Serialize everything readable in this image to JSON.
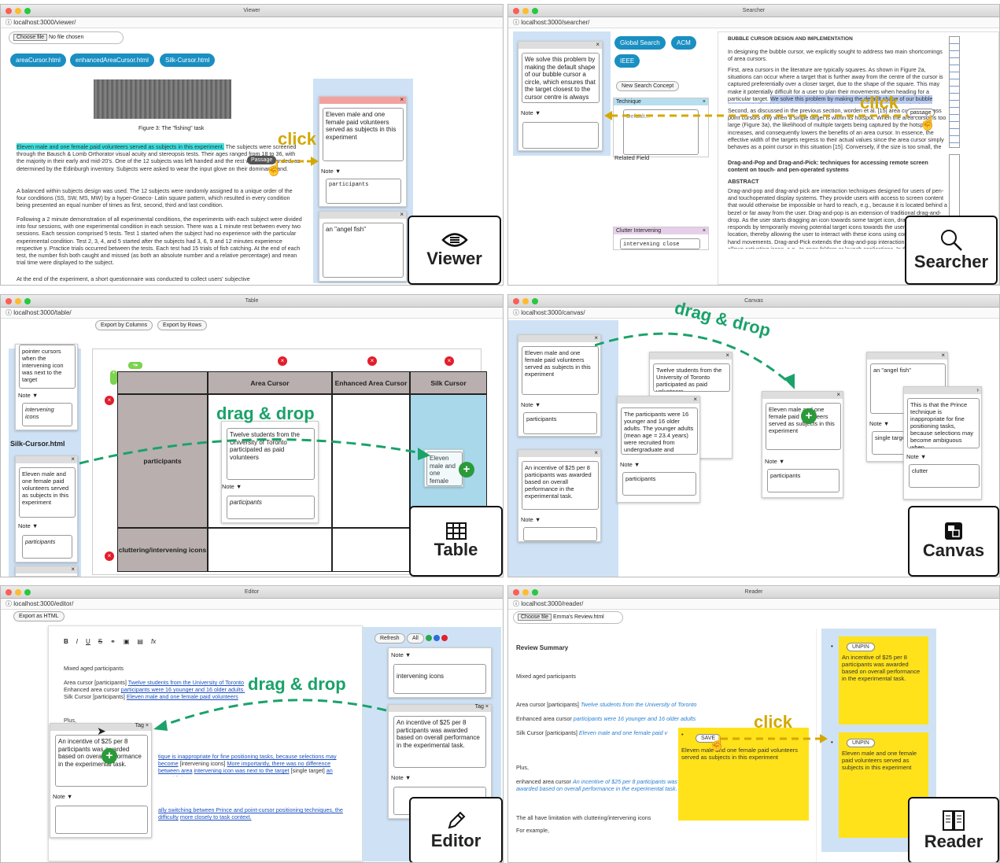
{
  "colors": {
    "accent": "#1a8fc2",
    "click": "#d4a800",
    "drag": "#1aa26a",
    "yellow": "#ffe21a",
    "panel": "#cfe2f5",
    "tableHead": "#b9afaf"
  },
  "viewer": {
    "title": "Viewer",
    "url": "localhost:3000/viewer/",
    "choose": "Choose file",
    "nofile": "No file chosen",
    "tabs": [
      "areaCursor.html",
      "enhancedAreaCursor.html",
      "Silk-Cursor.html"
    ],
    "caption": "Figure 3: The \"fishing\" task",
    "highlight": "Eleven male and one female paid volunteers served as subjects in this experiment.",
    "p1rest": " The subjects were screened through the Bausch & Lomb Orthorator visual acuity and stereopsis tests. Their ages ranged from 18 to 36, with the majority in their early and mid-20's. One of the 12 subjects was left handed and the rest were right handed, as determined by the Edinburgh inventory. Subjects were asked to wear the input glove on their dominant hand.",
    "p2": "A balanced within subjects design was used. The 12 subjects were randomly assigned to a unique order of the four conditions (SS, SW, MS, MW) by a hyper-Graeco- Latin square pattern, which resulted in every condition being presented an equal number of times as first, second, third and last condition.",
    "p3": "Following a 2 minute demonstration of all experimental conditions, the experiments with each subject were divided into four sessions, with one experimental condition in each session. There was a 1 minute rest between every two sessions. Each session comprised 5 tests. Test 1 started when the subject had no experience with the particular experimental condition. Test 2, 3, 4, and 5 started after the subjects had 3, 6, 9 and 12 minutes experience respective y. Practice trials occurred between the tests. Each test had 15 trials of fish catching. At the end of each test, the number fish both caught and missed (as both an absolute number and a relative percentage) and mean trial time were displayed to the subject.",
    "p4": "At the end of the experiment, a short questionnaire was conducted to collect users' subjective",
    "passage": "Passage",
    "click": "click",
    "card1": "Eleven male and one female paid volunteers served as subjects in this experiment",
    "note": "Note ▼",
    "card1note": "participants",
    "card2": "an \"angel fish\"",
    "label": "Viewer"
  },
  "searcher": {
    "title": "Searcher",
    "url": "localhost:3000/searcher/",
    "card": "We solve this problem by making the default shape of our bubble cursor a circle, which ensures that the target closest to the cursor centre is always",
    "note": "Note ▼",
    "pills": [
      "Global Search",
      "ACM",
      "IEEE"
    ],
    "newConcept": "New Search Concept",
    "concept1": "Technique",
    "concept1val": "Default...",
    "related": "Related Field",
    "concept2": "Clutter Intervening",
    "concept2val": "intervening close",
    "h1": "BUBBLE CURSOR DESIGN AND IMPLEMENTATION",
    "t1": "In designing the bubble cursor, we explicitly sought to address two main shortcomings of area cursors.",
    "t2": "First, area cursors in the literature are typically squares. As shown in Figure 2a, situations can occur where a target that is further away from the centre of the cursor is captured preferentially over a closer target, due to the shape of the square. This may make it potentially difficult for a user to plan their movements when heading for a particular target.",
    "t2hl": "We solve this problem by making the default shape of our bubble cursor a circle, which ensures that the target closest to the cursor centre is always selected",
    "t3": "Second, as discussed in the previous section, worden et al. [15] area cursors surpass point cursors only when a single target is within its hotspot. When the area cursor is too large (Figure 3a), the likelihood of multiple targets being captured by the hotspot increases, and consequently lowers the benefits of an area cursor. In essence, the effective width of the targets regress to their actual values since the area cursor simply behaves as a point cursor in this situation [15]. Conversely, if the size is too small, the",
    "h2": "Drag-and-Pop and Drag-and-Pick: techniques for accessing remote screen content on touch- and pen-operated systems",
    "h3": "ABSTRACT",
    "t4": "Drag-and-pop and drag-and-pick are interaction techniques designed for users of pen- and touchoperated display systems. They provide users with access to screen content that would otherwise be impossible or hard to reach, e.g., because it is located behind a bezel or far away from the user. Drag-and-pop is an extension of traditional drag-and-drop. As the user starts dragging an icon towards some target icon, drag-and-pop responds by temporarily moving potential target icons towards the user's current cursor location, thereby allowing the user to interact with these icons using comparably small hand movements. Drag-and-Pick extends the drag-and-pop interaction style such that it allows activating icons, e.g., to open folders or launch applications. In this paper, we report the results",
    "passage": "passage",
    "click": "click",
    "label": "Searcher"
  },
  "table": {
    "title": "Table",
    "url": "localhost:3000/table/",
    "exportCols": "Export by Columns",
    "exportRows": "Export by Rows",
    "leftcard": "pointer cursors when the intervening icon was next to the target",
    "note": "Note ▼",
    "leftnote": "intervening icons",
    "fileLabel": "Silk-Cursor.html",
    "card2": "Eleven male and one female paid volunteers served as subjects in this experiment",
    "card2note": "participants",
    "cols": [
      "Area Cursor",
      "Enhanced Area Cursor",
      "Silk Cursor"
    ],
    "rows": [
      "participants",
      "cluttering/intervening icons"
    ],
    "cellcard": "Twelve students from the University of Toronto participated as paid volunteers",
    "cellnote": "participants",
    "dragcard": "Eleven male and one female paid volunteers served as subjects in this experiment",
    "drag": "drag & drop",
    "label": "Table"
  },
  "canvas": {
    "title": "Canvas",
    "url": "localhost:3000/canvas/",
    "c1": "Eleven male and one female paid volunteers served as subjects in this experiment",
    "c1note": "participants",
    "c2": "An incentive of $25 per 8 participants was awarded based on overall performance in the experimental task.",
    "c3": "Twelve students from the University of Toronto participated as paid volunteers",
    "c4": "The participants were 16 younger and 16 older adults. The younger adults (mean age = 23.4 years) were recruited from undergraduate and",
    "c4note": "participants",
    "c5": "Eleven male and one female paid volunteers served as subjects in this experiment",
    "c5note": "participants",
    "c6": "an \"angel fish\"",
    "c6note": "single target",
    "c7": "This is that the Prince technique is inappropriate for fine positioning tasks, because selections may become ambiguous when",
    "c7note": "clutter",
    "note": "Note ▼",
    "drag": "drag & drop",
    "label": "Canvas"
  },
  "editor": {
    "title": "Editor",
    "url": "localhost:3000/editor/",
    "export": "Export as HTML",
    "tools": [
      "B",
      "I",
      "U",
      "S",
      "⚭",
      "▣",
      "▤",
      "fx"
    ],
    "l1": "Mixed aged participants",
    "l2a": "Area cursor [participants]",
    "l2b": "Twelve students from the University of Toronto",
    "l3a": "Enhanced area cursor",
    "l3b": "participants were 16 younger and 16 older adults.",
    "l4a": "Silk Cursor [participants]",
    "l4b": "Eleven male and one female paid volunteers",
    "l5": "Plus,",
    "l6a": "tique is inappropriate for fine positioning tasks, because selections may become",
    "l6b": "[intervening icons]",
    "l6c": "More importantly, there was no difference between area",
    "l6d": "intervening icon was next to the target",
    "l6e": "[single target]",
    "l6f": "an \"angel fish\"",
    "l7a": "ally switching between Prince and point-cursor positioning techniques, the difficulty",
    "l7b": "more closely to task context.",
    "refresh": "Refresh",
    "all": "All",
    "tag": "Tag",
    "note": "Note ▼",
    "r1": "intervening icons",
    "r2": "An incentive of $25 per 8 participants was awarded based on overall performance in the experimental task.",
    "floatcard": "An incentive of $25 per 8 participants was awarded based on overall performance in the experimental task.",
    "drag": "drag & drop",
    "label": "Editor"
  },
  "reader": {
    "title": "Reader",
    "url": "localhost:3000/reader/",
    "choose": "Choose file",
    "file": "Emma's Review.html",
    "summary": "Review Summary",
    "s1": "Mixed aged participants",
    "s2a": "Area cursor [participants]",
    "s2b": "Twelve students from the University of Toronto",
    "s3a": "Enhanced area cursor",
    "s3b": "participants were 16 younger and 16 older adults",
    "s4a": "Silk Cursor [participants]",
    "s4b": "Eleven male and one female paid v",
    "s5": "Plus,",
    "s6a": "enhanced area cursor",
    "s6b": "An incentive of $25 per 8 participants was awarded based on overall performance in the experimental task.",
    "s7": "The all have limitation with cluttering/intervening icons",
    "s8": "For example,",
    "save": "SAVE",
    "savecard": "Eleven male and one female paid volunteers served as subjects in this experiment",
    "unpin": "UNPIN",
    "p1": "An incentive of $25 per 8 participants was awarded based on overall performance in the experimental task.",
    "p2": "Eleven male and one female paid volunteers served as subjects in this experiment",
    "click": "click",
    "label": "Reader"
  }
}
